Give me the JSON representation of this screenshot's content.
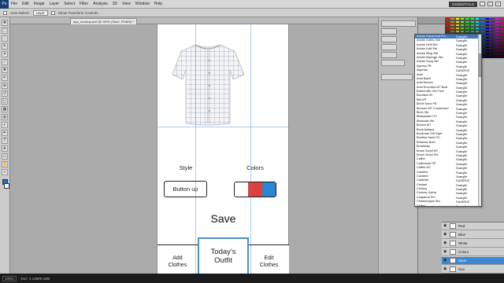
{
  "app": {
    "logo": "Ps",
    "menus": [
      "File",
      "Edit",
      "Image",
      "Layer",
      "Select",
      "Filter",
      "Analysis",
      "3D",
      "View",
      "Window",
      "Help"
    ],
    "workspace": "ESSENTIALS",
    "document_tab": "app_mockup.psd @ 100% (Save, RGB/8) *"
  },
  "options_bar": {
    "auto_select_label": "Auto-Select:",
    "auto_select_value": "Layer",
    "transform_label": "Show Transform Controls"
  },
  "tools": [
    "move-icon",
    "marquee-icon",
    "lasso-icon",
    "quick-select-icon",
    "crop-icon",
    "eyedropper-icon",
    "healing-icon",
    "brush-icon",
    "stamp-icon",
    "history-brush-icon",
    "eraser-icon",
    "gradient-icon",
    "blur-icon",
    "dodge-icon",
    "pen-icon",
    "type-icon",
    "path-select-icon",
    "shape-icon",
    "hand-icon",
    "zoom-icon"
  ],
  "mockup": {
    "style_label": "Style",
    "colors_label": "Colors",
    "style_button": "Button up",
    "color_swatches": [
      "#ffffff",
      "#e0403a",
      "#2a86d4"
    ],
    "save_label": "Save",
    "nav": [
      {
        "label": "Add\nClothes",
        "active": false
      },
      {
        "label": "Today's\nOutfit",
        "active": true
      },
      {
        "label": "Edit\nClothes",
        "active": false
      }
    ]
  },
  "font_menu": {
    "fonts": [
      {
        "name": "Adobe Garamond Pro",
        "sample": "Sample"
      },
      {
        "name": "Adobe Gothic Std",
        "sample": "Sample"
      },
      {
        "name": "Adobe Heiti Std",
        "sample": "Sample"
      },
      {
        "name": "Adobe Kaiti Std",
        "sample": "Sample"
      },
      {
        "name": "Adobe Ming Std",
        "sample": "Sample"
      },
      {
        "name": "Adobe Myungjo Std",
        "sample": "Sample"
      },
      {
        "name": "Adobe Song Std",
        "sample": "Sample"
      },
      {
        "name": "Agency FB",
        "sample": "Sample"
      },
      {
        "name": "Algerian",
        "sample": "SAMPLE"
      },
      {
        "name": "Arial",
        "sample": "Sample"
      },
      {
        "name": "Arial Black",
        "sample": "Sample"
      },
      {
        "name": "Arial Narrow",
        "sample": "Sample"
      },
      {
        "name": "Arial Rounded MT Bold",
        "sample": "Sample"
      },
      {
        "name": "Baskerville Old Face",
        "sample": "Sample"
      },
      {
        "name": "Bauhaus 93",
        "sample": "Sample"
      },
      {
        "name": "Bell MT",
        "sample": "Sample"
      },
      {
        "name": "Berlin Sans FB",
        "sample": "Sample"
      },
      {
        "name": "Bernard MT Condensed",
        "sample": "Sample"
      },
      {
        "name": "Birch Std",
        "sample": "Sample"
      },
      {
        "name": "Blackadder ITC",
        "sample": "Sample"
      },
      {
        "name": "Blackoak Std",
        "sample": "Sample"
      },
      {
        "name": "Bodoni MT",
        "sample": "Sample"
      },
      {
        "name": "Book Antiqua",
        "sample": "Sample"
      },
      {
        "name": "Bookman Old Style",
        "sample": "Sample"
      },
      {
        "name": "Bradley Hand ITC",
        "sample": "Sample"
      },
      {
        "name": "Britannic Bold",
        "sample": "Sample"
      },
      {
        "name": "Broadway",
        "sample": "Sample"
      },
      {
        "name": "Brush Script MT",
        "sample": "Sample"
      },
      {
        "name": "Brush Script Std",
        "sample": "Sample"
      },
      {
        "name": "Calibri",
        "sample": "Sample"
      },
      {
        "name": "Californian FB",
        "sample": "Sample"
      },
      {
        "name": "Calisto MT",
        "sample": "Sample"
      },
      {
        "name": "Cambria",
        "sample": "Sample"
      },
      {
        "name": "Candara",
        "sample": "Sample"
      },
      {
        "name": "Castellar",
        "sample": "SAMPLE"
      },
      {
        "name": "Centaur",
        "sample": "Sample"
      },
      {
        "name": "Century",
        "sample": "Sample"
      },
      {
        "name": "Century Gothic",
        "sample": "Sample"
      },
      {
        "name": "Chaparral Pro",
        "sample": "Sample"
      },
      {
        "name": "Charlemagne Std",
        "sample": "SAMPLE"
      },
      {
        "name": "Chiller",
        "sample": "Sample"
      },
      {
        "name": "Colonna MT",
        "sample": "Sample"
      }
    ]
  },
  "layers": [
    {
      "name": "Red"
    },
    {
      "name": "Blue"
    },
    {
      "name": "White"
    },
    {
      "name": "Colors"
    },
    {
      "name": "Save"
    },
    {
      "name": "Nav"
    }
  ],
  "status": {
    "zoom": "100%",
    "doc": "Doc: 1.14M/9.43M"
  }
}
